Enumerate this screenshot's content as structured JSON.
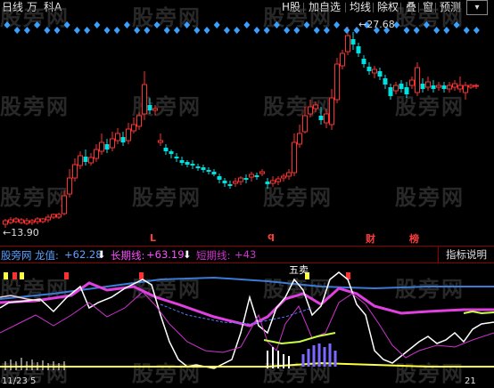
{
  "toolbar": {
    "items_left": [
      "日线",
      "万",
      "科A"
    ],
    "items_right": [
      "H股",
      "加自选",
      "均线",
      "除权",
      "叠",
      "窗",
      "预测"
    ]
  },
  "price_labels": {
    "high": "27.68",
    "low": "13.90"
  },
  "markers": {
    "l": "L",
    "q": "q",
    "cai": "财",
    "bang": "榜"
  },
  "indicator_bar": {
    "name": "股旁网",
    "dragon_label": "龙值:",
    "dragon_value": "+62.28",
    "long_label": "长期线:",
    "long_value": "+63.19",
    "short_label": "短期线:",
    "short_value": "+43",
    "help_button": "指标说明"
  },
  "lower_annotations": {
    "sell_signal": "五卖",
    "axis_left": "11/23 5",
    "axis_right": "21"
  },
  "watermark": "股旁网",
  "colors": {
    "up": "#ff3030",
    "down": "#00e0e0",
    "bg": "#000000",
    "dragon": "#5aa0ff",
    "long": "#ff4dff",
    "short": "#cc33cc",
    "blue_line": "#3a7bd5",
    "magenta_line": "#e040e0",
    "yellow_line": "#ffff40"
  },
  "icons": [
    "arrow-down-icon",
    "diamond-marker-icon",
    "candlestick-icon"
  ]
}
